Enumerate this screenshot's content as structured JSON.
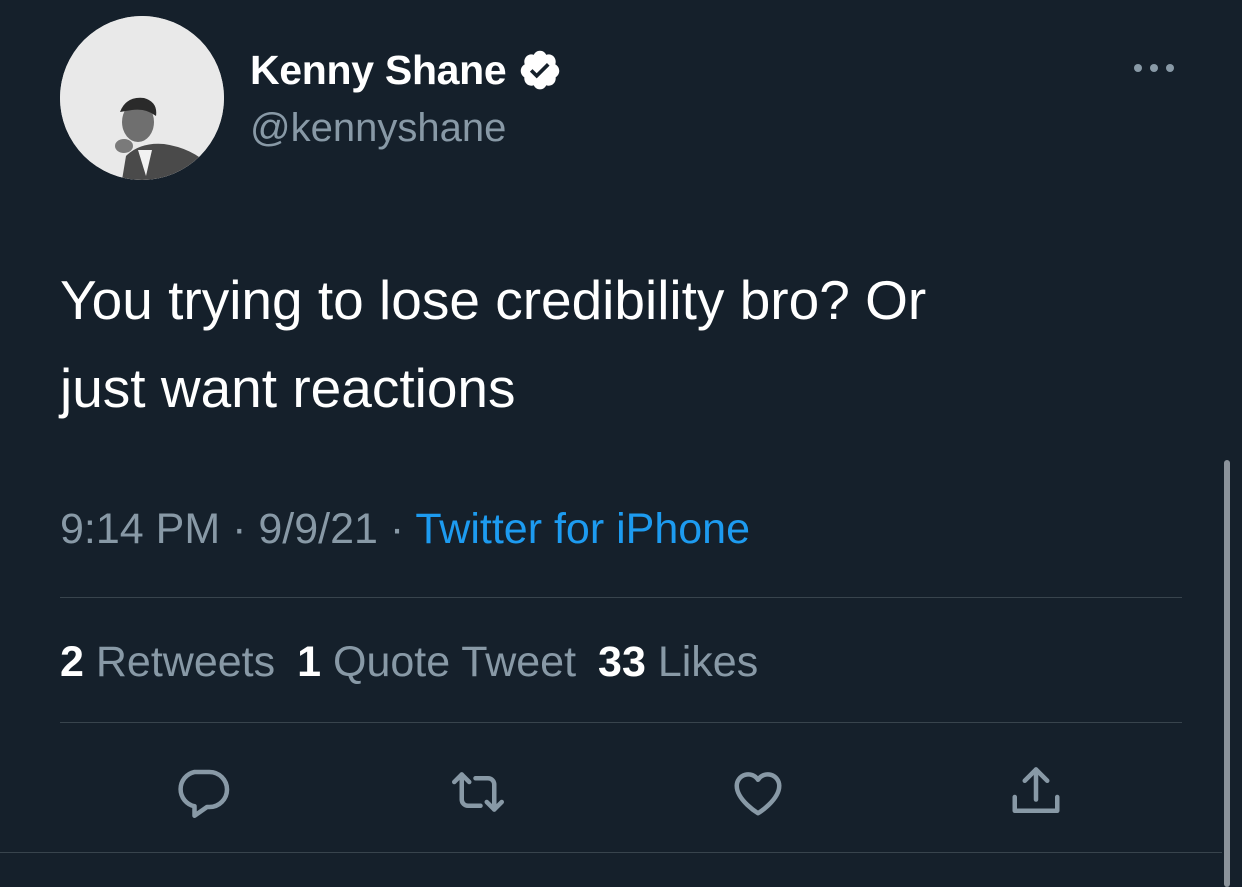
{
  "tweet": {
    "author": {
      "display_name": "Kenny Shane",
      "handle": "@kennyshane",
      "verified": true,
      "avatar_icon": "profile-photo-icon"
    },
    "text": "You trying to lose credibility bro? Or\njust want reactions",
    "time": "9:14 PM",
    "date": "9/9/21",
    "separator": "·",
    "source": "Twitter for iPhone"
  },
  "stats": {
    "retweets_count": "2",
    "retweets_label": "Retweets",
    "quotes_count": "1",
    "quotes_label": "Quote Tweet",
    "likes_count": "33",
    "likes_label": "Likes"
  },
  "actions": [
    {
      "name": "reply",
      "icon": "reply-icon"
    },
    {
      "name": "retweet",
      "icon": "retweet-icon"
    },
    {
      "name": "like",
      "icon": "heart-icon"
    },
    {
      "name": "share",
      "icon": "share-icon"
    }
  ],
  "colors": {
    "background": "#15202b",
    "primary_text": "#ffffff",
    "secondary_text": "#8899a6",
    "accent": "#1d9bf0",
    "divider": "#38444d"
  }
}
